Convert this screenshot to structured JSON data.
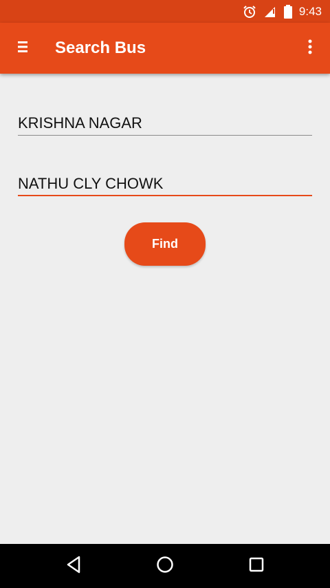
{
  "status_bar": {
    "time": "9:43",
    "icons": [
      "alarm-icon",
      "signal-icon",
      "battery-icon"
    ]
  },
  "app_bar": {
    "title": "Search Bus",
    "icons": [
      "menu-icon",
      "more-vert-icon"
    ]
  },
  "form": {
    "source_value": "KRISHNA NAGAR",
    "destination_value": "NATHU CLY CHOWK",
    "find_label": "Find"
  },
  "nav_bar": {
    "icons": [
      "back-icon",
      "home-icon",
      "recents-icon"
    ]
  },
  "colors": {
    "status_bar": "#d84315",
    "app_bar": "#e64a19",
    "accent": "#e64a19",
    "background": "#eeeeee"
  }
}
